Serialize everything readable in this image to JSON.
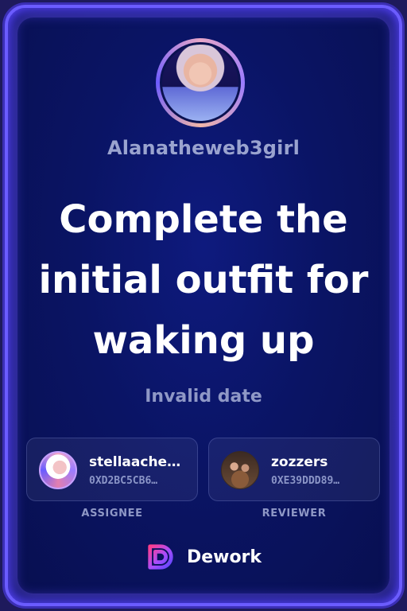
{
  "profile": {
    "username": "Alanatheweb3girl"
  },
  "task": {
    "title": "Complete the initial outfit for waking up",
    "date_text": "Invalid date"
  },
  "assignee": {
    "name": "stellaache…",
    "address": "0XD2BC5CB6…",
    "role_label": "ASSIGNEE"
  },
  "reviewer": {
    "name": "zozzers",
    "address": "0XE39DDD89…",
    "role_label": "REVIEWER"
  },
  "brand": {
    "name": "Dework",
    "logo_icon": "dework-logo-icon",
    "accent_colors": [
      "#ff3d8b",
      "#a64dff",
      "#5b46ff"
    ]
  },
  "colors": {
    "card_background": "#0a1464",
    "border": "#6b5cff",
    "muted_text": "#8f98c6"
  }
}
